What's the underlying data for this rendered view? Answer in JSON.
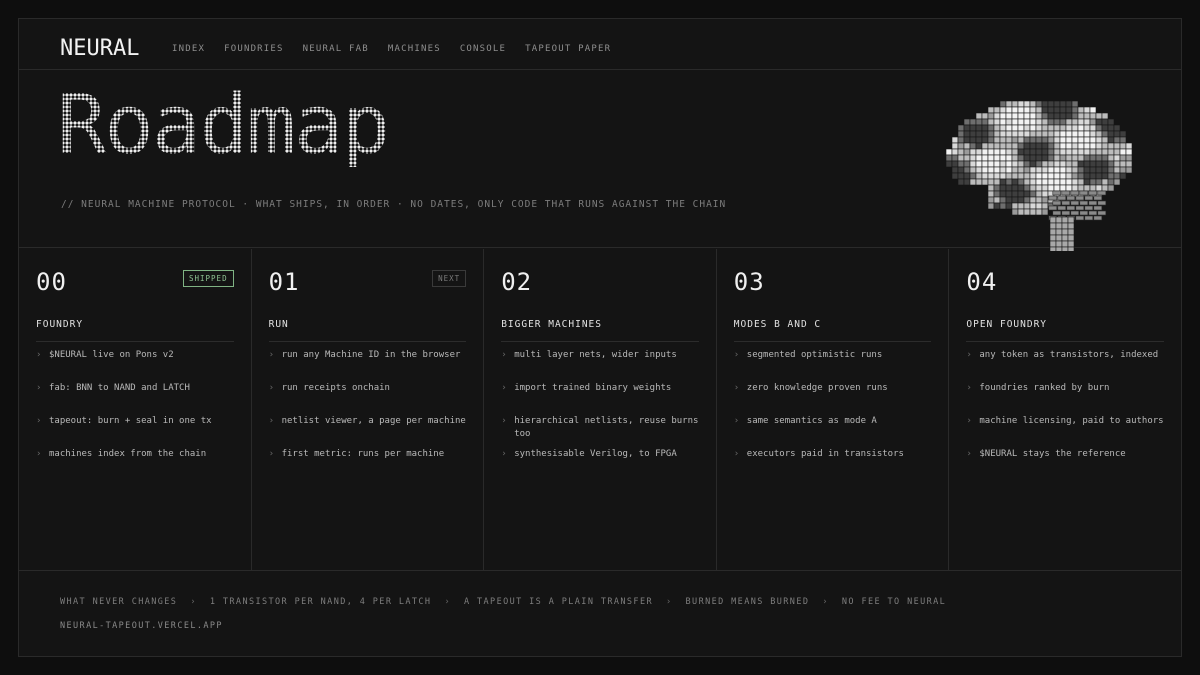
{
  "nav": {
    "logo": "NEURAL",
    "links": [
      "INDEX",
      "FOUNDRIES",
      "NEURAL FAB",
      "MACHINES",
      "CONSOLE",
      "TAPEOUT PAPER"
    ]
  },
  "hero": {
    "title": "Roadmap",
    "subtitle": "// NEURAL MACHINE PROTOCOL · WHAT SHIPS, IN ORDER · NO DATES, ONLY CODE THAT RUNS AGAINST THE CHAIN",
    "image_icon": "pixel-brain-icon"
  },
  "columns": [
    {
      "num": "00",
      "badge": "SHIPPED",
      "title": "FOUNDRY",
      "items": [
        "$NEURAL live on Pons v2",
        "fab: BNN to NAND and LATCH",
        "tapeout: burn + seal in one tx",
        "machines index from the chain"
      ]
    },
    {
      "num": "01",
      "badge": "NEXT",
      "title": "RUN",
      "items": [
        "run any Machine ID in the browser",
        "run receipts onchain",
        "netlist viewer, a page per machine",
        "first metric: runs per machine"
      ]
    },
    {
      "num": "02",
      "badge": "",
      "title": "BIGGER MACHINES",
      "items": [
        "multi layer nets, wider inputs",
        "import trained binary weights",
        "hierarchical netlists, reuse burns too",
        "synthesisable Verilog, to FPGA"
      ]
    },
    {
      "num": "03",
      "badge": "",
      "title": "MODES B AND C",
      "items": [
        "segmented optimistic runs",
        "zero knowledge proven runs",
        "same semantics as mode A",
        "executors paid in transistors"
      ]
    },
    {
      "num": "04",
      "badge": "",
      "title": "OPEN FOUNDRY",
      "items": [
        "any token as transistors, indexed",
        "foundries ranked by burn",
        "machine licensing, paid to authors",
        "$NEURAL stays the reference"
      ]
    }
  ],
  "footer": {
    "label": "WHAT NEVER CHANGES",
    "rules": [
      "1 TRANSISTOR PER NAND, 4 PER LATCH",
      "A TAPEOUT IS A PLAIN TRANSFER",
      "BURNED MEANS BURNED",
      "NO FEE TO NEURAL"
    ],
    "separator": "›",
    "url": "NEURAL-TAPEOUT.VERCEL.APP"
  },
  "colors": {
    "background": "#0e0e0e",
    "panel": "#141414",
    "border": "#2a2a2a",
    "shipped_badge": "#8fc493"
  }
}
